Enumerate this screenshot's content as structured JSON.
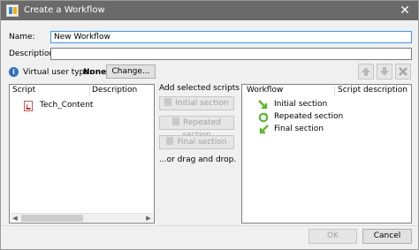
{
  "window": {
    "title": "Create a Workflow",
    "close_glyph": "✕"
  },
  "form": {
    "name_label": "Name:",
    "name_value": "New Workflow",
    "description_label": "Description:",
    "description_value": ""
  },
  "virtual_user": {
    "label": "Virtual user type:",
    "value": "None",
    "change_button": "Change..."
  },
  "scripts_panel": {
    "columns": [
      "Script",
      "Description"
    ],
    "items": [
      {
        "name": "Tech_Content",
        "description": ""
      }
    ]
  },
  "middle": {
    "heading": "Add selected scripts to:",
    "buttons": [
      "Initial section",
      "Repeated section",
      "Final section"
    ],
    "drag_hint": "...or drag and drop."
  },
  "workflow_panel": {
    "columns": [
      "Workflow",
      "Script description"
    ],
    "items": [
      "Initial section",
      "Repeated section",
      "Final section"
    ]
  },
  "toolbar": {
    "icons": [
      "move-up-icon",
      "move-down-icon",
      "delete-icon"
    ]
  },
  "footer": {
    "ok_label": "OK",
    "cancel_label": "Cancel"
  },
  "colors": {
    "titlebar": "#6a6a6a",
    "accent_focus": "#3399ff",
    "section_green": "#5cb82e",
    "info_blue": "#2f6fc6"
  }
}
